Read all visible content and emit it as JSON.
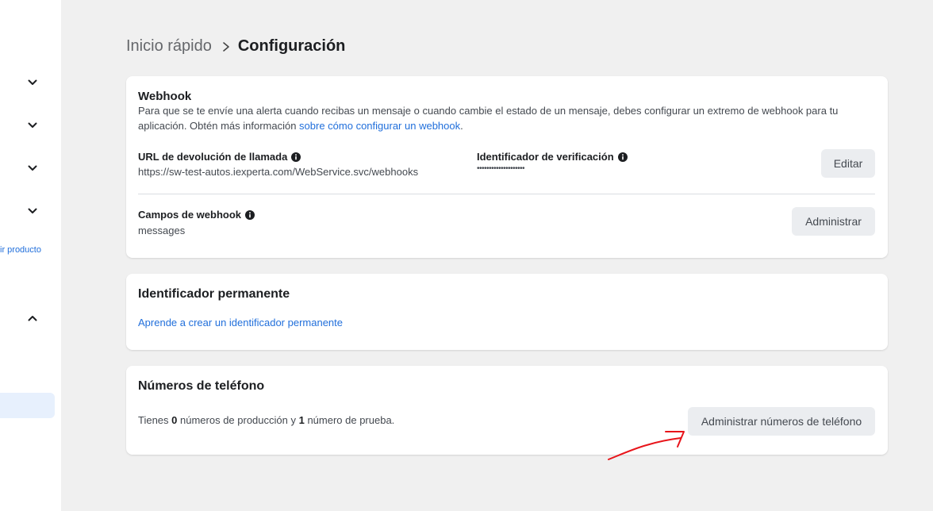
{
  "sidebar": {
    "partial_link": "ir producto",
    "chevrons": [
      "chevron-down-icon",
      "chevron-down-icon",
      "chevron-down-icon",
      "chevron-down-icon",
      "chevron-up-icon"
    ]
  },
  "breadcrumb": {
    "previous": "Inicio rápido",
    "separator_icon": "chevron-right-icon",
    "current": "Configuración"
  },
  "webhook": {
    "title": "Webhook",
    "description_text": "Para que se te envíe una alerta cuando recibas un mensaje o cuando cambie el estado de un mensaje, debes configurar un extremo de webhook para tu aplicación. Obtén más información ",
    "description_link": "sobre cómo configurar un webhook",
    "description_end": ".",
    "callback_label": "URL de devolución de llamada",
    "callback_value": "https://sw-test-autos.iexperta.com/WebService.svc/webhooks",
    "verify_label": "Identificador de verificación",
    "verify_value": "••••••••••••••••••••",
    "edit_button": "Editar",
    "fields_label": "Campos de webhook",
    "fields_value": "messages",
    "manage_button": "Administrar"
  },
  "permanent_id": {
    "title": "Identificador permanente",
    "link": "Aprende a crear un identificador permanente"
  },
  "phones": {
    "title": "Números de teléfono",
    "text_prefix": "Tienes ",
    "production_count": "0",
    "text_middle": " números de producción y ",
    "test_count": "1",
    "text_suffix": " número de prueba.",
    "manage_button": "Administrar números de teléfono"
  },
  "colors": {
    "link": "#216fdb",
    "annotation": "#e8141a",
    "page_bg": "#f0f0f0",
    "button_bg": "#ebedf0"
  }
}
